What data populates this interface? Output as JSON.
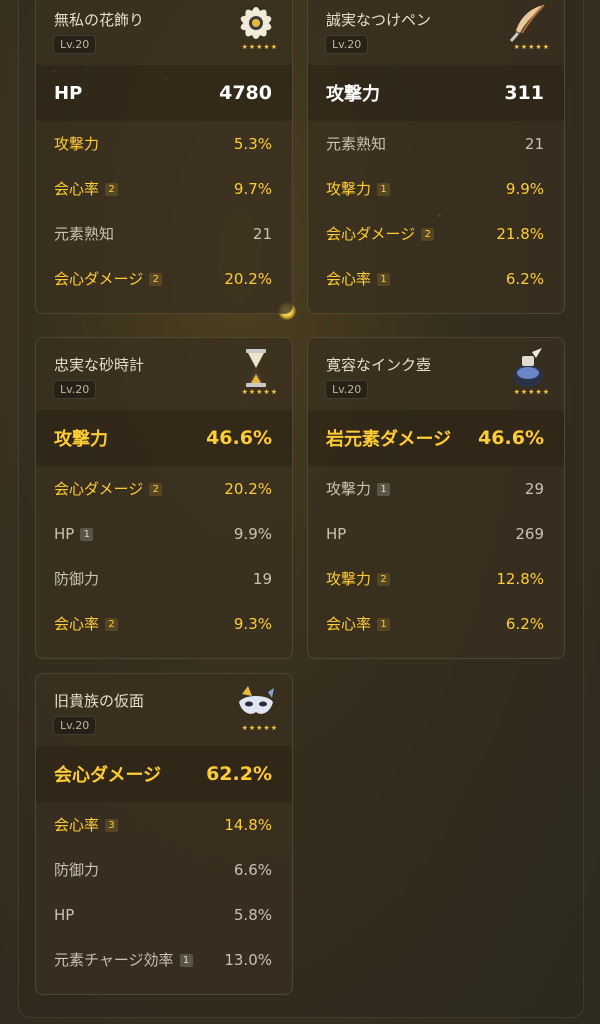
{
  "artifacts": [
    {
      "name": "無私の花飾り",
      "level": "Lv.20",
      "icon": "flower-icon",
      "stars": "★★★★★",
      "main": {
        "label": "HP",
        "value": "4780",
        "color": "white"
      },
      "subs": [
        {
          "label": "攻撃力",
          "rolls": "",
          "value": "5.3%",
          "color": "gold"
        },
        {
          "label": "会心率",
          "rolls": "2",
          "value": "9.7%",
          "color": "gold"
        },
        {
          "label": "元素熟知",
          "rolls": "",
          "value": "21",
          "color": "gray"
        },
        {
          "label": "会心ダメージ",
          "rolls": "2",
          "value": "20.2%",
          "color": "gold"
        }
      ]
    },
    {
      "name": "誠実なつけペン",
      "level": "Lv.20",
      "icon": "feather-icon",
      "stars": "★★★★★",
      "main": {
        "label": "攻撃力",
        "value": "311",
        "color": "white"
      },
      "subs": [
        {
          "label": "元素熟知",
          "rolls": "",
          "value": "21",
          "color": "gray"
        },
        {
          "label": "攻撃力",
          "rolls": "1",
          "value": "9.9%",
          "color": "gold"
        },
        {
          "label": "会心ダメージ",
          "rolls": "2",
          "value": "21.8%",
          "color": "gold"
        },
        {
          "label": "会心率",
          "rolls": "1",
          "value": "6.2%",
          "color": "gold"
        }
      ]
    },
    {
      "name": "忠実な砂時計",
      "level": "Lv.20",
      "icon": "hourglass-icon",
      "stars": "★★★★★",
      "main": {
        "label": "攻撃力",
        "value": "46.6%",
        "color": "gold"
      },
      "subs": [
        {
          "label": "会心ダメージ",
          "rolls": "2",
          "value": "20.2%",
          "color": "gold"
        },
        {
          "label": "HP",
          "rolls": "1",
          "value": "9.9%",
          "color": "gray"
        },
        {
          "label": "防御力",
          "rolls": "",
          "value": "19",
          "color": "gray"
        },
        {
          "label": "会心率",
          "rolls": "2",
          "value": "9.3%",
          "color": "gold"
        }
      ]
    },
    {
      "name": "寛容なインク壺",
      "level": "Lv.20",
      "icon": "ink-pot-icon",
      "stars": "★★★★★",
      "main": {
        "label": "岩元素ダメージ",
        "value": "46.6%",
        "color": "gold"
      },
      "subs": [
        {
          "label": "攻撃力",
          "rolls": "1",
          "value": "29",
          "color": "gray"
        },
        {
          "label": "HP",
          "rolls": "",
          "value": "269",
          "color": "gray"
        },
        {
          "label": "攻撃力",
          "rolls": "2",
          "value": "12.8%",
          "color": "gold"
        },
        {
          "label": "会心率",
          "rolls": "1",
          "value": "6.2%",
          "color": "gold"
        }
      ]
    },
    {
      "name": "旧貴族の仮面",
      "level": "Lv.20",
      "icon": "mask-icon",
      "stars": "★★★★★",
      "main": {
        "label": "会心ダメージ",
        "value": "62.2%",
        "color": "gold"
      },
      "subs": [
        {
          "label": "会心率",
          "rolls": "3",
          "value": "14.8%",
          "color": "gold"
        },
        {
          "label": "防御力",
          "rolls": "",
          "value": "6.6%",
          "color": "gray"
        },
        {
          "label": "HP",
          "rolls": "",
          "value": "5.8%",
          "color": "gray"
        },
        {
          "label": "元素チャージ効率",
          "rolls": "1",
          "value": "13.0%",
          "color": "gray"
        }
      ]
    }
  ]
}
